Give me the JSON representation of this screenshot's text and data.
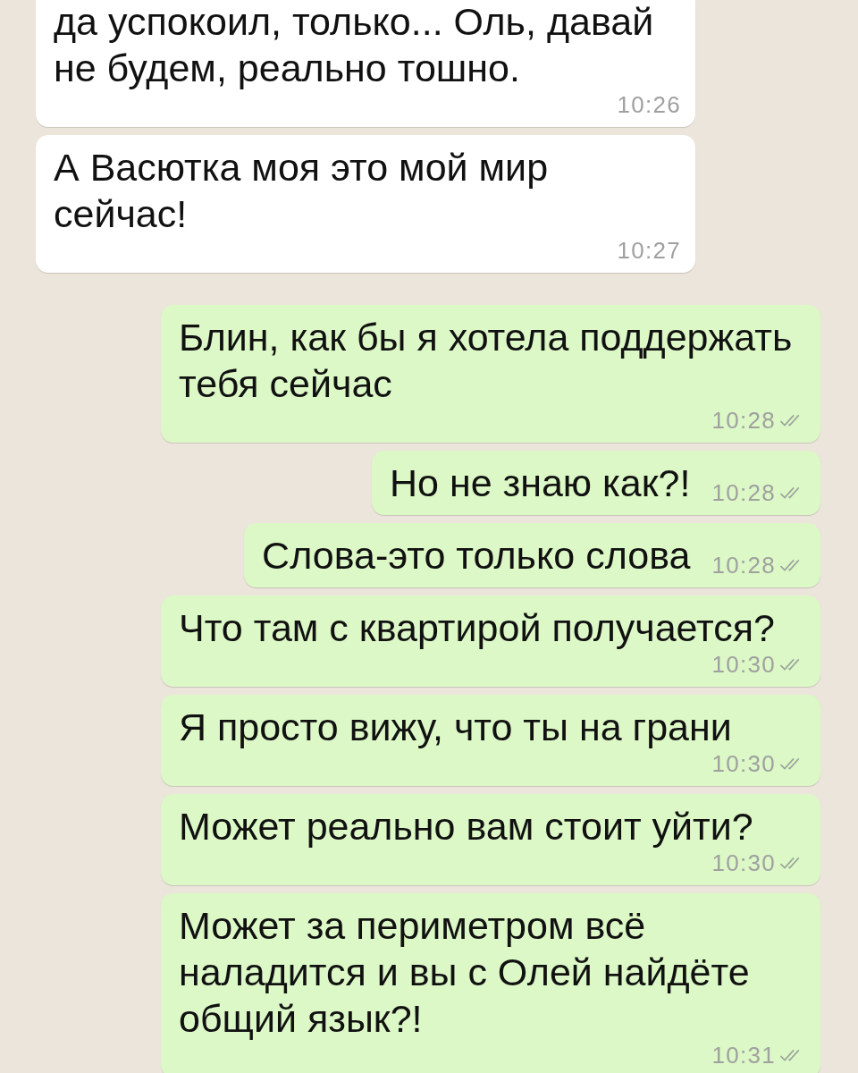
{
  "messages": [
    {
      "kind": "incoming",
      "text": "да успокоил, только... Оль, давай не будем, реально тошно.",
      "time": "10:26"
    },
    {
      "kind": "incoming",
      "text": "А Васютка моя это мой мир сейчас!",
      "time": "10:27"
    },
    {
      "kind": "outgoing",
      "text": "Блин, как бы я хотела поддержать тебя сейчас",
      "time": "10:28",
      "read": false
    },
    {
      "kind": "outgoing",
      "text": "Но не знаю как?!",
      "time": "10:28",
      "read": false
    },
    {
      "kind": "outgoing",
      "text": "Слова-это только слова",
      "time": "10:28",
      "read": false
    },
    {
      "kind": "outgoing",
      "text": "Что там с квартирой получается?",
      "time": "10:30",
      "read": false
    },
    {
      "kind": "outgoing",
      "text": "Я просто вижу, что ты на грани",
      "time": "10:30",
      "read": false
    },
    {
      "kind": "outgoing",
      "text": "Может реально вам стоит уйти?",
      "time": "10:30",
      "read": false
    },
    {
      "kind": "outgoing",
      "text": "Может за периметром всё наладится и вы с Олей найдёте общий язык?!",
      "time": "10:31",
      "read": false
    }
  ]
}
